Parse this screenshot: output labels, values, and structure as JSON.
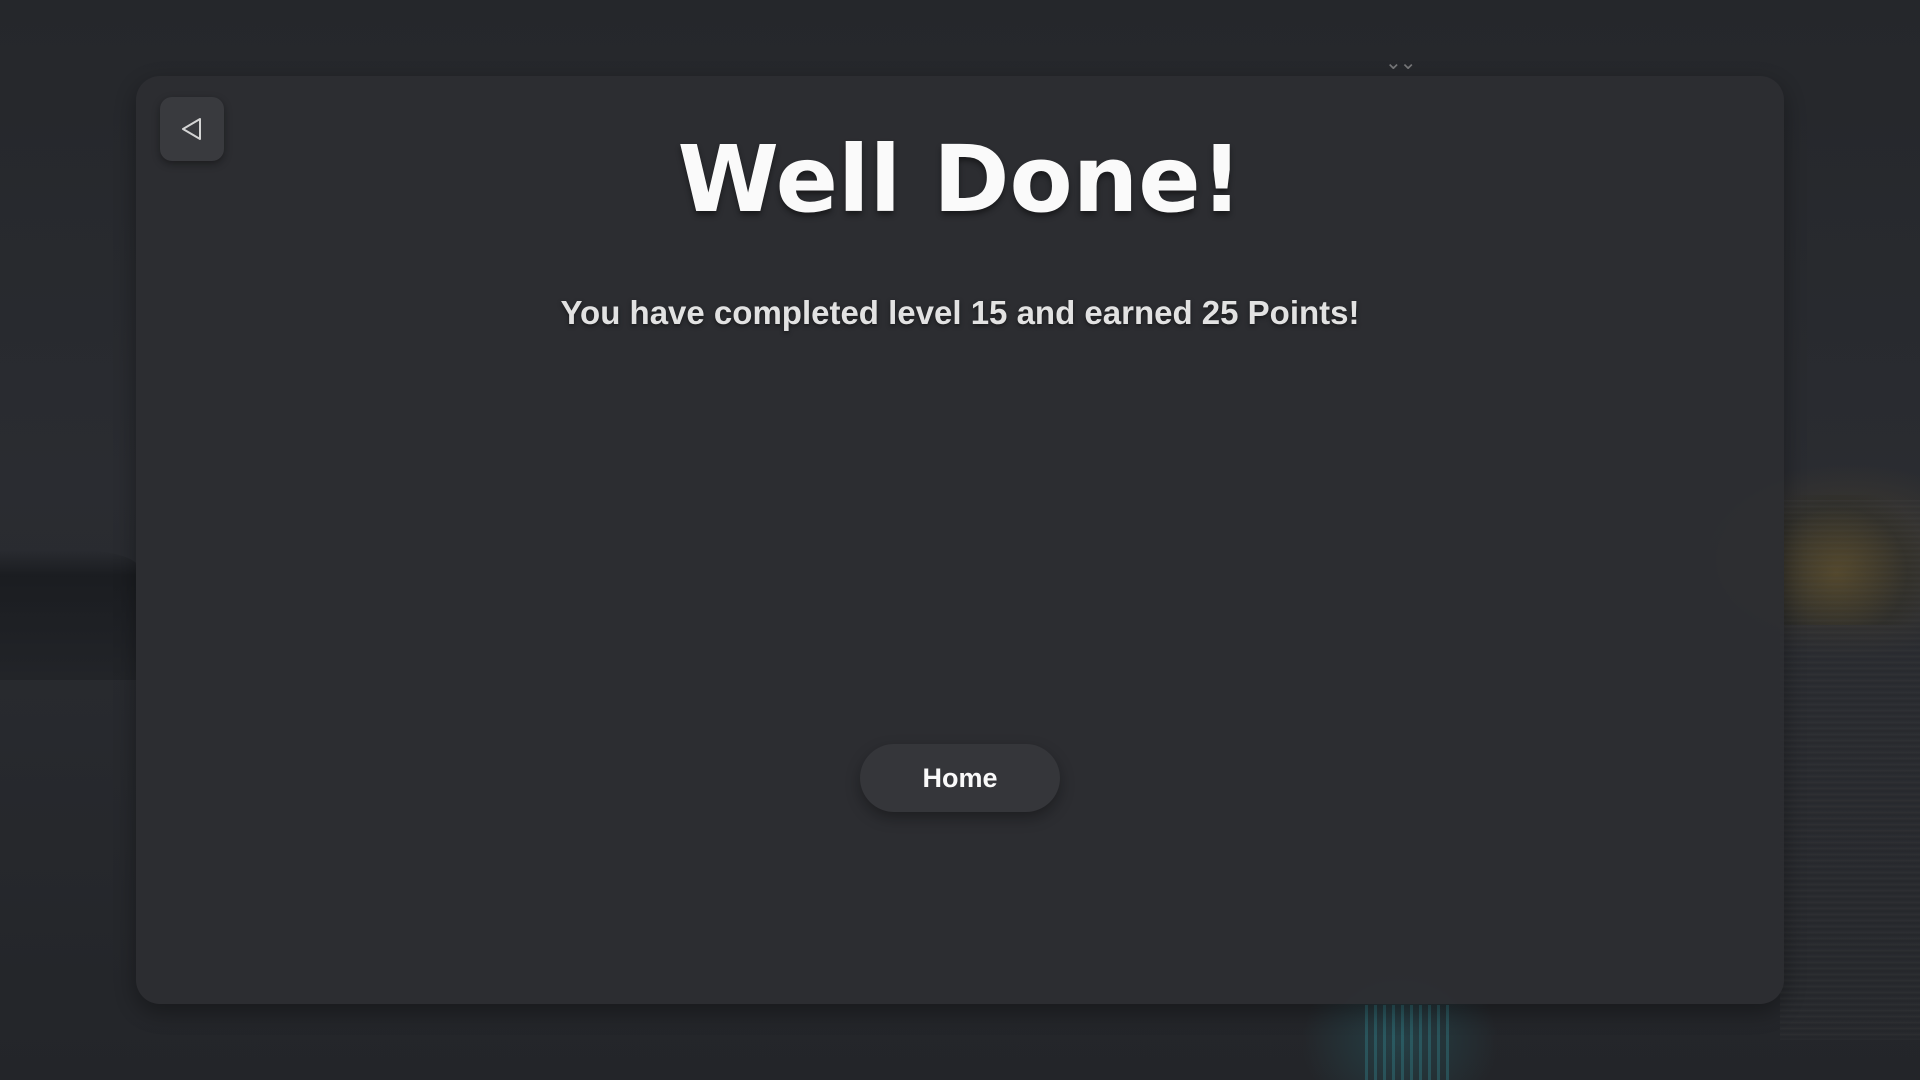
{
  "screen": {
    "title": "Well Done!",
    "message": "You have completed level 15 and earned 25 Points!"
  },
  "controls": {
    "back_icon": "back-triangle-icon",
    "home_label": "Home"
  },
  "colors": {
    "card_background": "#2d2e32",
    "button_background": "#36373b",
    "title_text": "#ffffff",
    "message_text": "#e6e6e6"
  }
}
